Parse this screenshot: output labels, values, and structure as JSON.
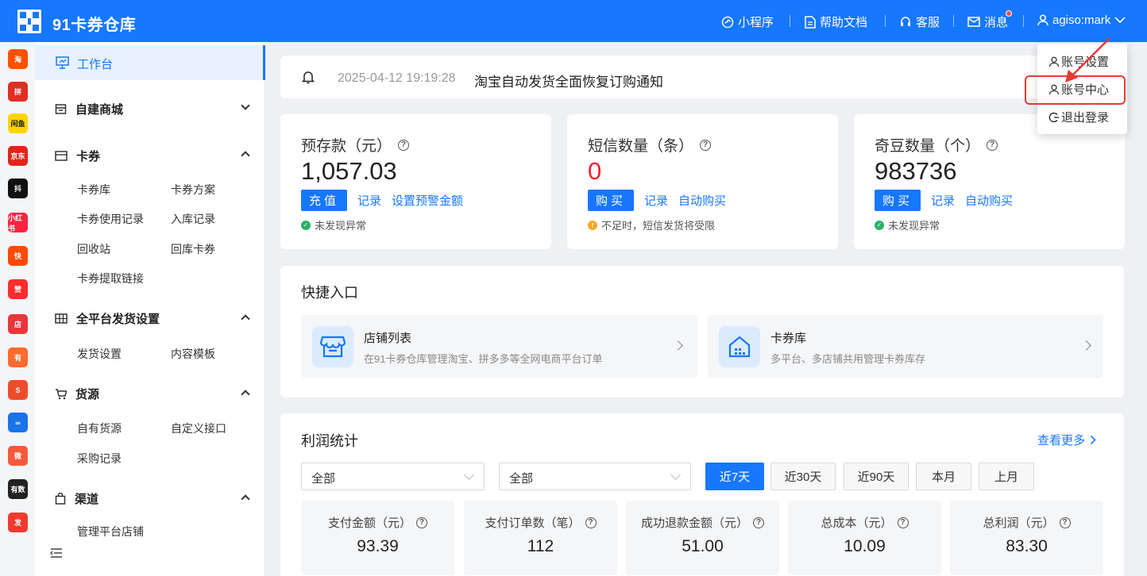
{
  "header": {
    "brand": "91卡券仓库",
    "nav": [
      {
        "label": "小程序",
        "icon": "mini-program-icon"
      },
      {
        "label": "帮助文档",
        "icon": "document-icon"
      },
      {
        "label": "客服",
        "icon": "headset-icon"
      },
      {
        "label": "消息",
        "icon": "mail-icon",
        "unread": true
      }
    ],
    "user": "agiso:mark"
  },
  "platforms": [
    {
      "name": "taobao",
      "text": "淘",
      "color": "#ff5000"
    },
    {
      "name": "pinduoduo",
      "text": "拼",
      "color": "#e02e24"
    },
    {
      "name": "xianyu",
      "text": "闲鱼",
      "color": "#ffd400"
    },
    {
      "name": "jd",
      "text": "京东",
      "color": "#e1251b"
    },
    {
      "name": "douyin",
      "text": "抖",
      "color": "#111111"
    },
    {
      "name": "xiaohongshu",
      "text": "小红书",
      "color": "#ff2442"
    },
    {
      "name": "kuaishou",
      "text": "快",
      "color": "#ff4906"
    },
    {
      "name": "dianzan",
      "text": "赞",
      "color": "#ff2d2d"
    },
    {
      "name": "dian",
      "text": "店",
      "color": "#e8363b"
    },
    {
      "name": "youzan",
      "text": "有",
      "color": "#ff6a2f"
    },
    {
      "name": "shopee",
      "text": "S",
      "color": "#ee4d2d"
    },
    {
      "name": "link",
      "text": "∞",
      "color": "#1a73e8"
    },
    {
      "name": "weidian",
      "text": "微",
      "color": "#f55a3c"
    },
    {
      "name": "youshu",
      "text": "有数",
      "color": "#222222"
    },
    {
      "name": "shipping",
      "text": "发",
      "color": "#f03a2e"
    }
  ],
  "sidebar": {
    "workbench": "工作台",
    "groups": [
      {
        "label": "自建商城",
        "icon": "shop-icon",
        "expanded": false,
        "items": []
      },
      {
        "label": "卡券",
        "icon": "card-icon",
        "expanded": true,
        "items": [
          "卡券库",
          "卡券方案",
          "卡券使用记录",
          "入库记录",
          "回收站",
          "回库卡券",
          "卡券提取链接"
        ]
      },
      {
        "label": "全平台发货设置",
        "icon": "grid-icon",
        "expanded": true,
        "items": [
          "发货设置",
          "内容模板"
        ]
      },
      {
        "label": "货源",
        "icon": "cart-icon",
        "expanded": true,
        "items": [
          "自有货源",
          "自定义接口",
          "采购记录"
        ]
      },
      {
        "label": "渠道",
        "icon": "bag-icon",
        "expanded": true,
        "items": [
          "管理平台店铺"
        ]
      }
    ]
  },
  "notice": {
    "date": "2025-04-12 19:19:28",
    "text": "淘宝自动发货全面恢复订购通知"
  },
  "stats": [
    {
      "title": "预存款（元）",
      "value": "1,057.03",
      "value_color": "#222222",
      "primary": "充值",
      "links": [
        "记录",
        "设置预警金额"
      ],
      "status": "未发现异常",
      "status_type": "ok"
    },
    {
      "title": "短信数量（条）",
      "value": "0",
      "value_color": "#f5222d",
      "primary": "购买",
      "links": [
        "记录",
        "自动购买"
      ],
      "status": "不足时，短信发货将受限",
      "status_type": "warn"
    },
    {
      "title": "奇豆数量（个）",
      "value": "983736",
      "value_color": "#222222",
      "primary": "购买",
      "links": [
        "记录",
        "自动购买"
      ],
      "status": "未发现异常",
      "status_type": "ok"
    }
  ],
  "quick": {
    "title": "快捷入口",
    "entries": [
      {
        "name": "店铺列表",
        "desc": "在91卡券仓库管理淘宝、拼多多等全网电商平台订单",
        "icon": "store-icon"
      },
      {
        "name": "卡券库",
        "desc": "多平台、多店铺共用管理卡券库存",
        "icon": "warehouse-icon"
      }
    ]
  },
  "profit": {
    "title": "利润统计",
    "more": "查看更多",
    "filters": [
      "全部",
      "全部"
    ],
    "ranges": [
      "近7天",
      "近30天",
      "近90天",
      "本月",
      "上月"
    ],
    "active_range": "近7天",
    "metrics": [
      {
        "label": "支付金额（元）",
        "value": "93.39"
      },
      {
        "label": "支付订单数（笔）",
        "value": "112"
      },
      {
        "label": "成功退款金额（元）",
        "value": "51.00"
      },
      {
        "label": "总成本（元）",
        "value": "10.09"
      },
      {
        "label": "总利润（元）",
        "value": "83.30"
      }
    ]
  },
  "user_menu": {
    "items": [
      "账号设置",
      "账号中心",
      "退出登录"
    ],
    "highlighted": "账号中心"
  }
}
